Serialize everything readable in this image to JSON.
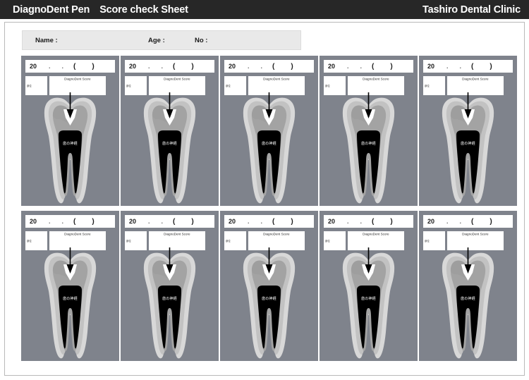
{
  "header": {
    "title": "DiagnoDent Pen",
    "subtitle": "Score check Sheet",
    "clinic": "Tashiro Dental Clinic"
  },
  "patient": {
    "name_label": "Name :",
    "age_label": "Age :",
    "no_label": "No :"
  },
  "card": {
    "date_year_prefix": "20",
    "date_separator": ".",
    "paren_open": "(",
    "paren_close": ")",
    "site_label": "部位",
    "score_label": "DiagnoDent Score",
    "pulp_label": "歯の神経"
  },
  "colors": {
    "header_bar": "#272727",
    "card_panel": "#7f838c",
    "patient_strip": "#e9e9e9",
    "enamel_outer": "#d8d8d8",
    "enamel_inner": "#c2c2c2",
    "dentin": "#a3a3a3",
    "dentin_shadow": "#8f8f8f",
    "pulp": "#000000",
    "fissure": "#ffffff",
    "arrow": "#000000",
    "page_border": "#b9b9b9"
  },
  "grid": {
    "rows": 2,
    "columns": 5,
    "total_cards": 10
  }
}
